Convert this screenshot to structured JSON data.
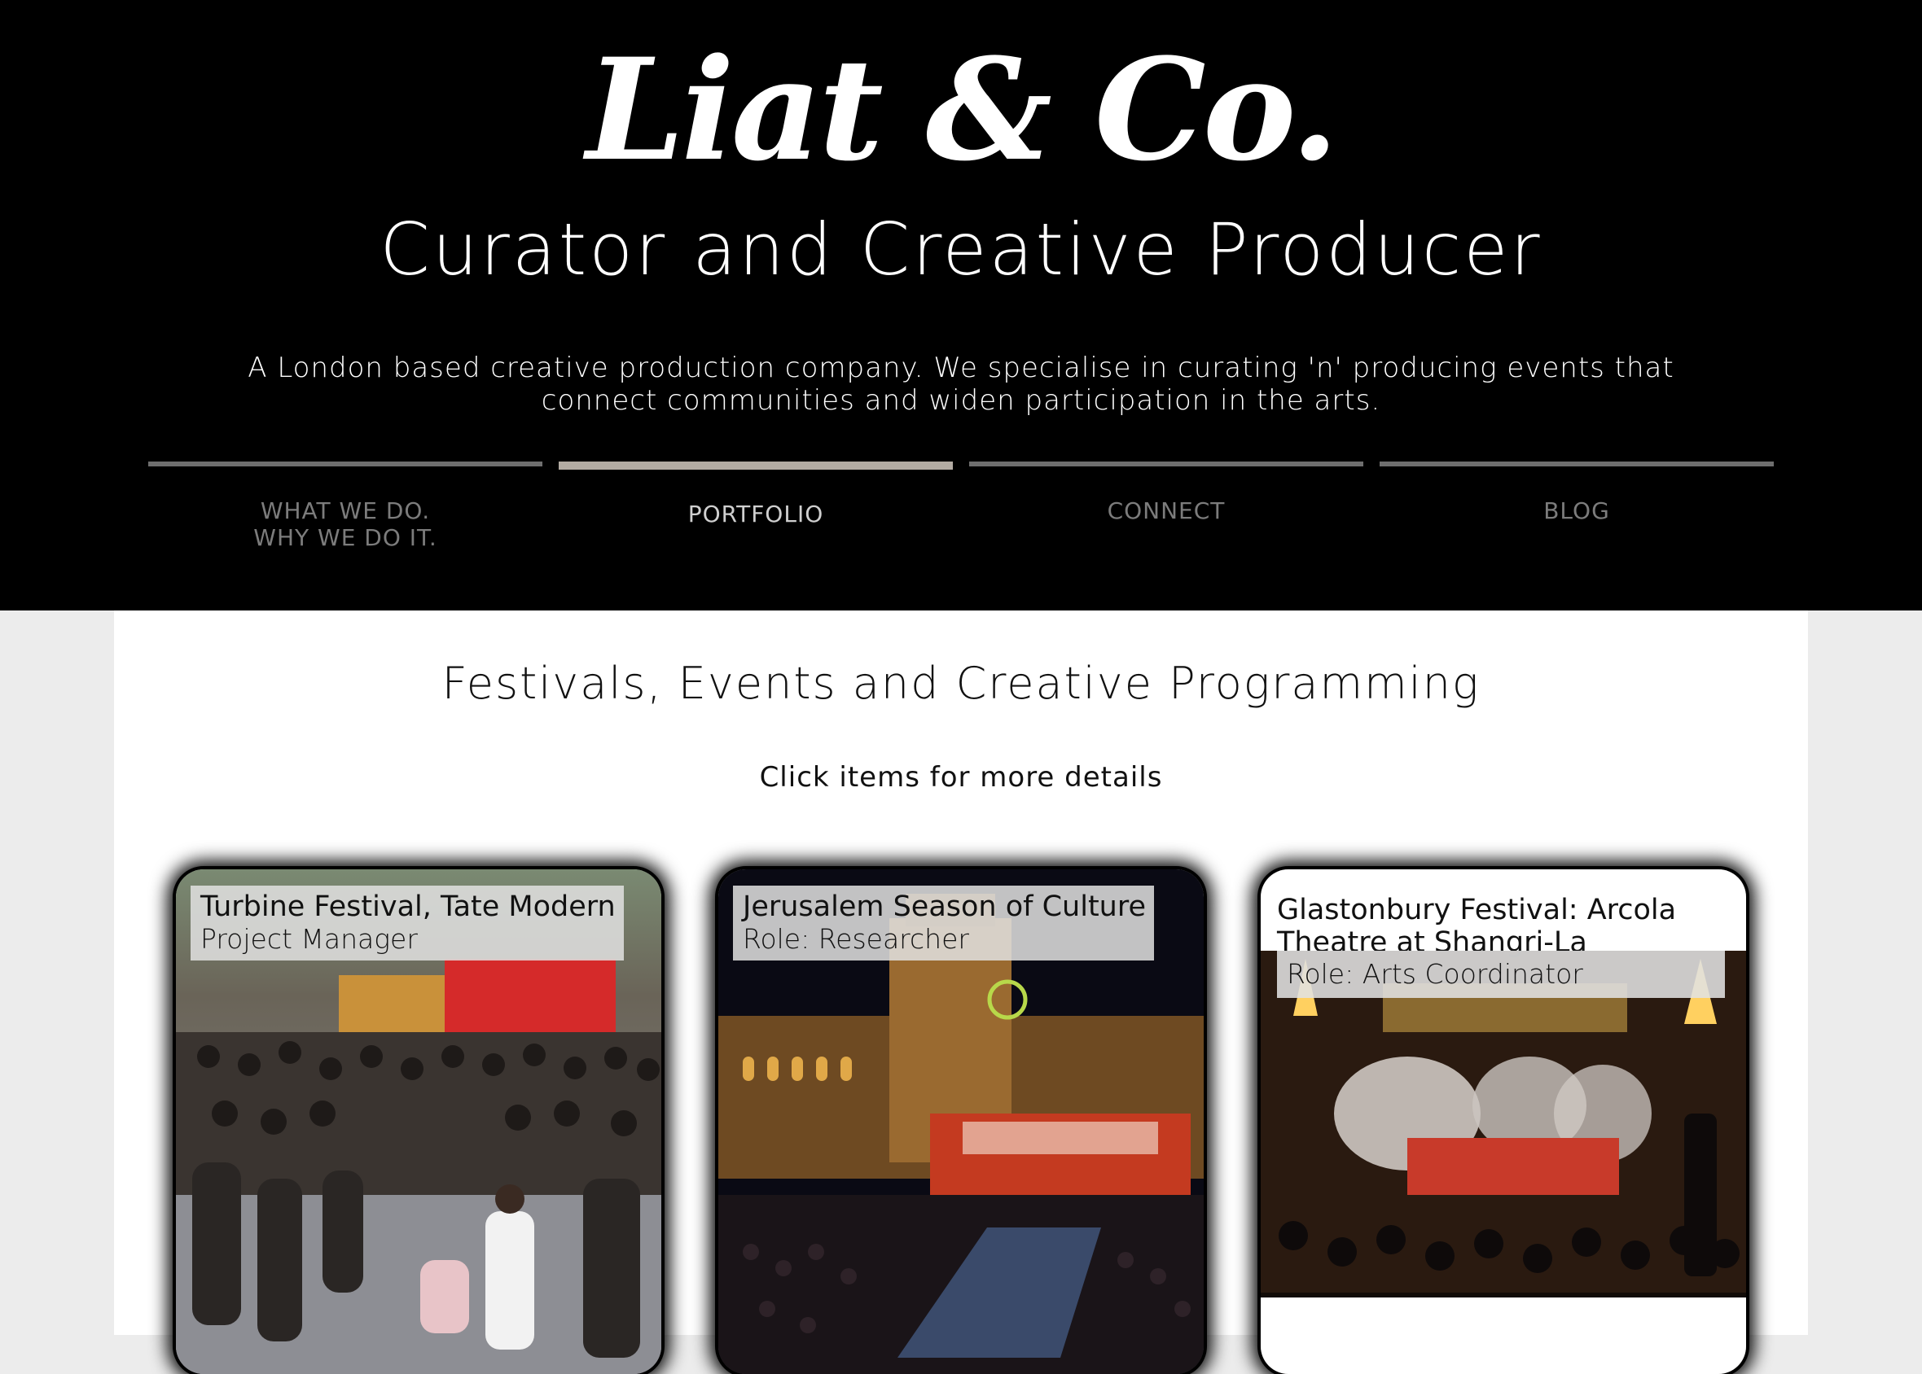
{
  "header": {
    "logo_text": "Liat & Co.",
    "tagline": "Curator and Creative Producer",
    "intro": "A London based creative production company. We specialise in curating 'n' producing events that connect communities and widen participation in the arts.",
    "nav": [
      {
        "label": "WHAT WE DO.\nWHY WE DO IT.",
        "active": false
      },
      {
        "label": "PORTFOLIO",
        "active": true
      },
      {
        "label": "CONNECT",
        "active": false
      },
      {
        "label": "BLOG",
        "active": false
      }
    ]
  },
  "main": {
    "section_title": "Festivals, Events and Creative Programming",
    "hint": "Click items for more details",
    "cards": [
      {
        "title": "Turbine Festival, Tate Modern",
        "role": "Project Manager"
      },
      {
        "title": "Jerusalem Season of Culture",
        "role": "Role: Researcher"
      },
      {
        "title": "Glastonbury Festival: Arcola Theatre at Shangri-La",
        "role": "Role: Arts Coordinator"
      }
    ]
  },
  "colors": {
    "header_bg": "#000000",
    "page_bg": "#ececec",
    "nav_bar": "#6e6e6e",
    "nav_bar_active": "#b3aca3"
  }
}
